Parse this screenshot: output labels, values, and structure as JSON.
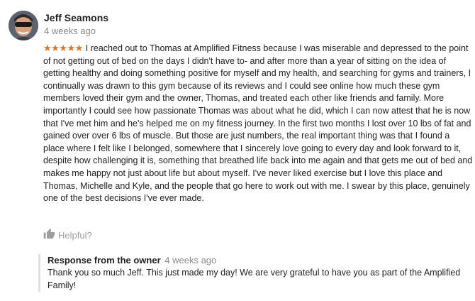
{
  "review": {
    "author_name": "Jeff Seamons",
    "date": "4 weeks ago",
    "rating": 5,
    "stars": "★★★★★",
    "text": "I reached out to Thomas at Amplified Fitness because I was miserable and depressed to the point of not getting out of bed on the days I didn't have to-  and after more than a year of sitting on the idea of getting healthy and doing something positive for myself and my health, and searching for gyms and trainers, I continually was drawn to this gym because of its reviews and I could see online how much these gym members loved their gym and the owner, Thomas, and treated each other like friends and family. More importantly I could see how passionate Thomas was about what he did, which I can now attest that he is now that I've met him and he's helped me on my fitness journey. In the first two months I lost over 10 lbs of fat and gained over over 6 lbs of muscle. But those are just numbers, the real important thing was that I found a place where I felt like I belonged, somewhere that I sincerely love going to every day and look forward to it, despite how challenging it is, something that breathed life back into me again and that gets me out of bed and makes me happy not just about life but about myself. I've never liked exercise but I love this place and Thomas, Michelle and Kyle, and the people that go here to work out with me. I swear by this place, genuinely one of the best decisions I've ever made.",
    "helpful_label": "Helpful?",
    "helpful_icon": "thumbs-up-icon"
  },
  "owner_response": {
    "title": "Response from the owner",
    "date": "4 weeks ago",
    "text": "Thank you so much Jeff. This just made my day! We are very grateful to have you as part of the Amplified Family!"
  },
  "colors": {
    "star": "#e7711b",
    "name": "#212121",
    "muted": "#8a8a8a",
    "response_border": "#e0e0e0"
  }
}
